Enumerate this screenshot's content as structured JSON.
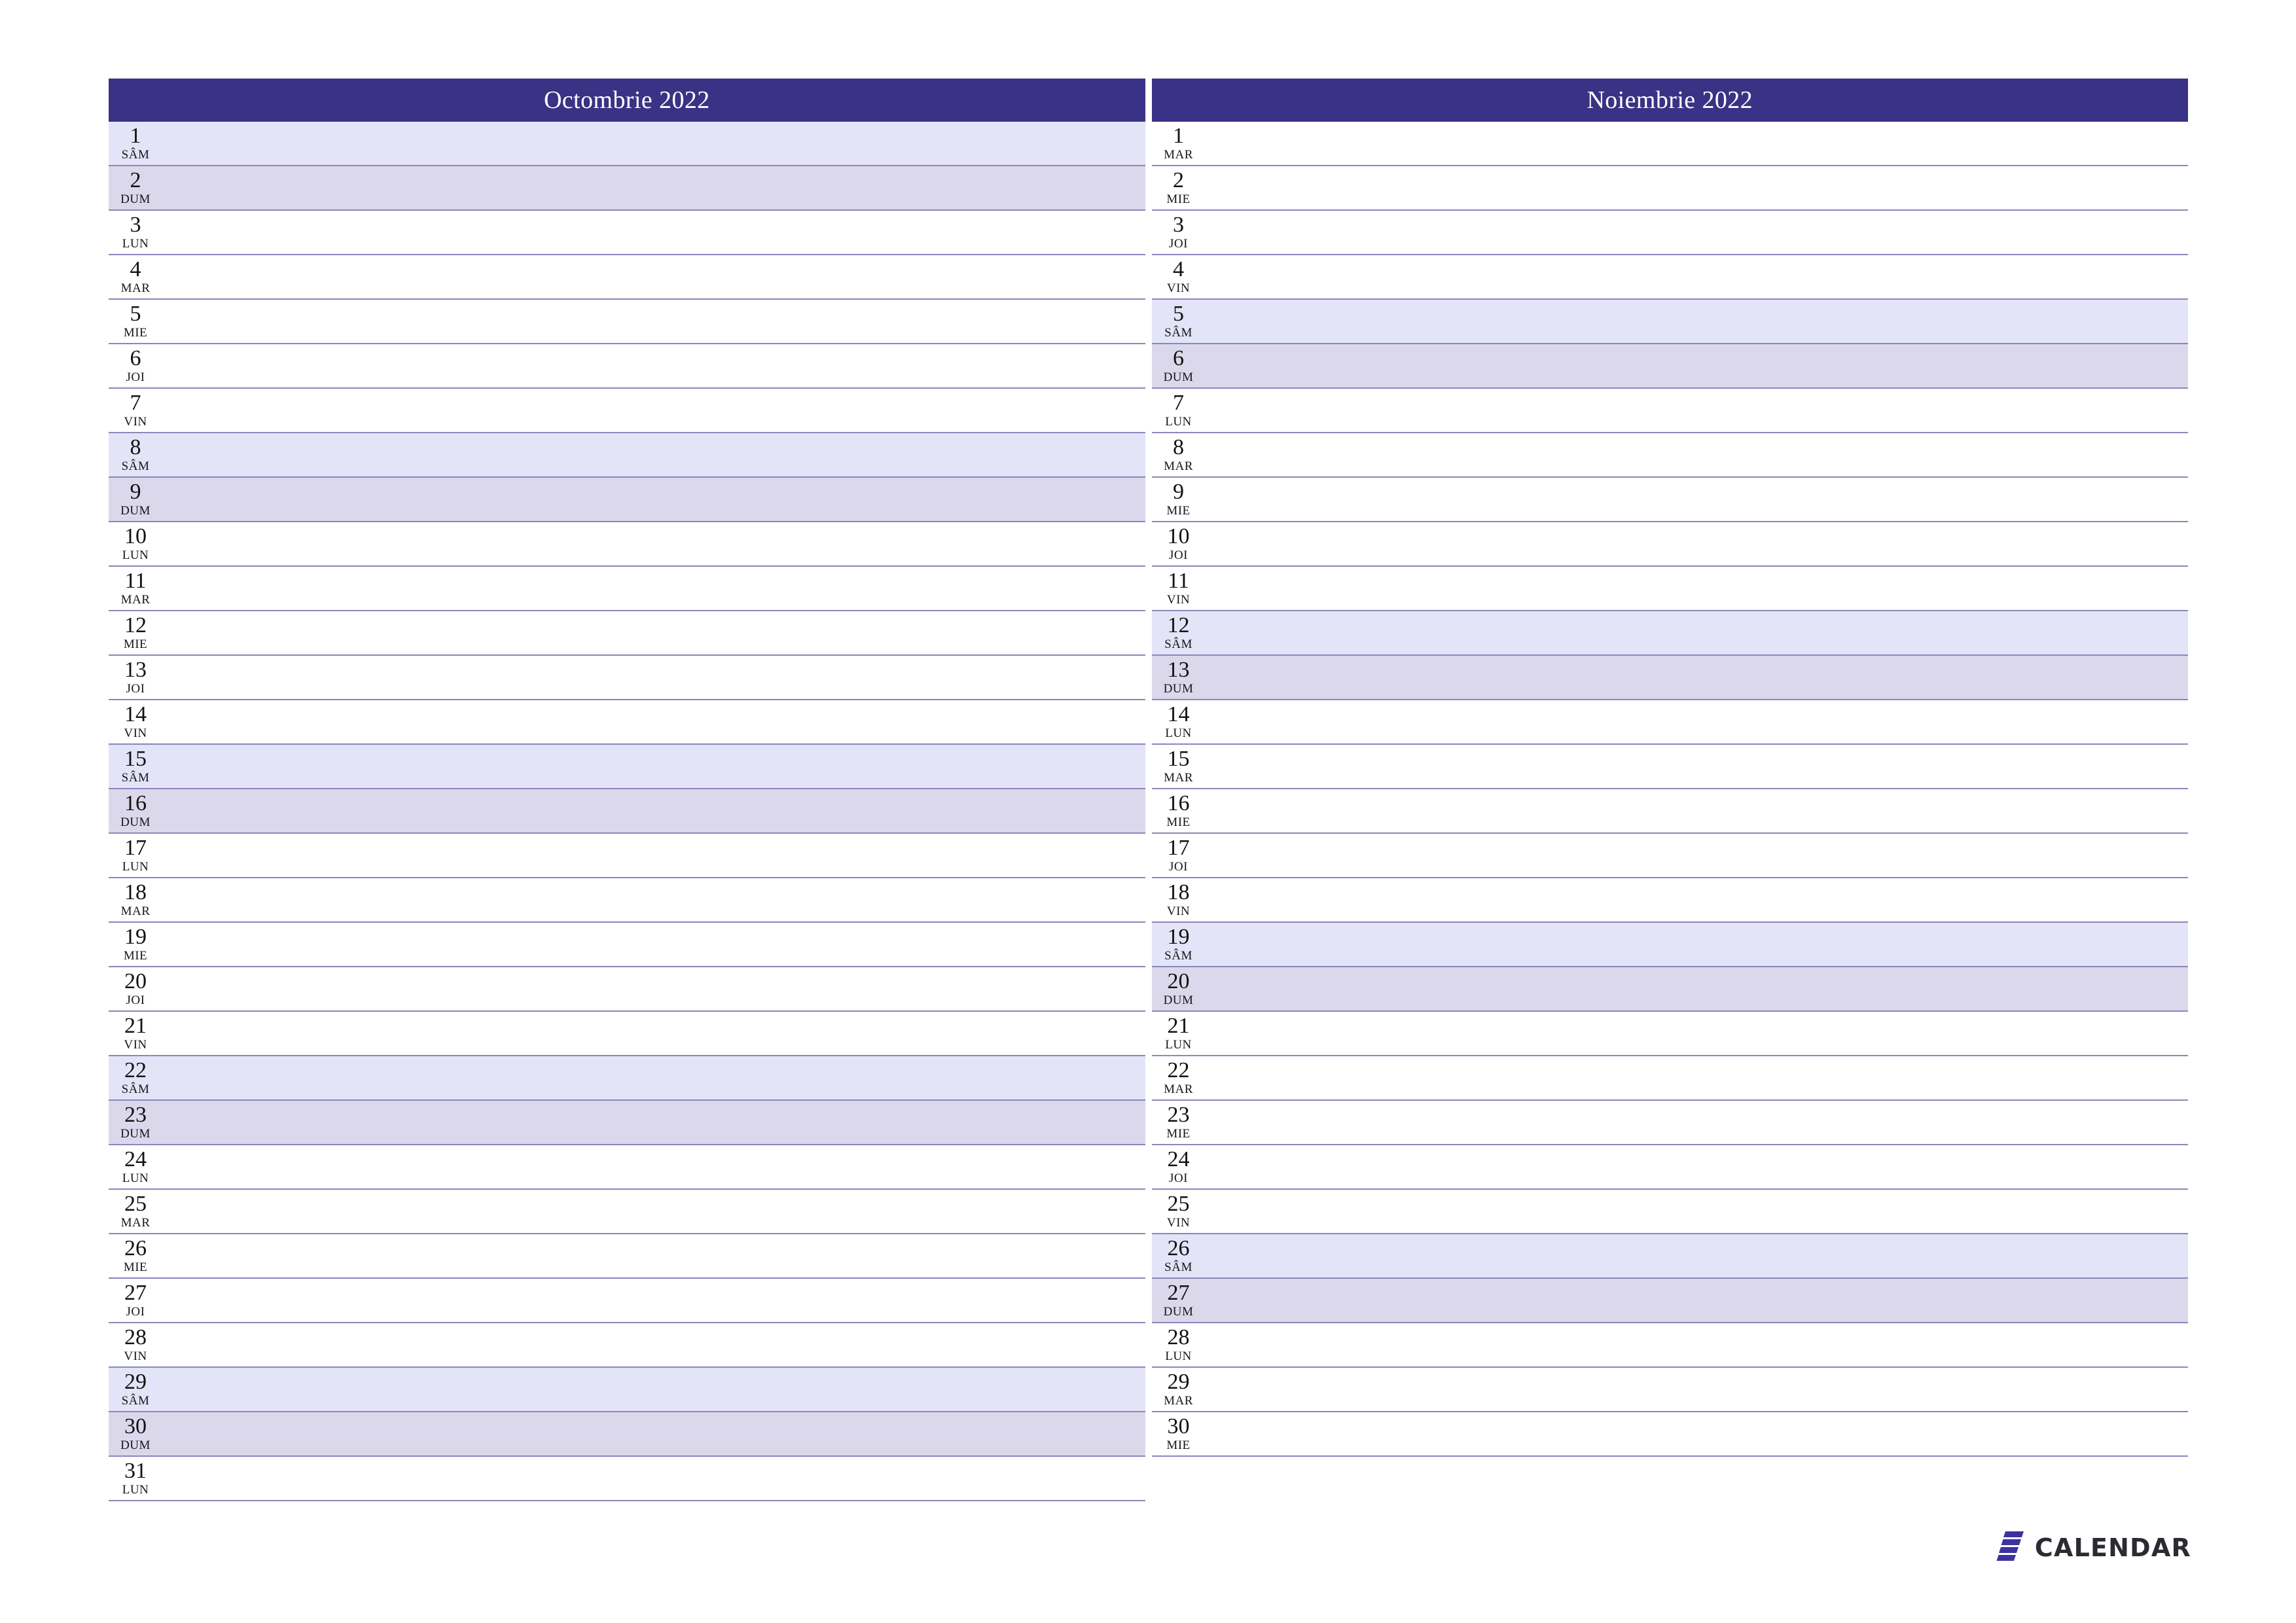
{
  "document": {
    "type": "monthly-planner",
    "language": "ro",
    "orientation": "landscape"
  },
  "months": [
    {
      "title": "Octombrie 2022",
      "days": [
        {
          "num": "1",
          "name": "SÂM",
          "kind": "sat"
        },
        {
          "num": "2",
          "name": "DUM",
          "kind": "sun"
        },
        {
          "num": "3",
          "name": "LUN",
          "kind": "weekday"
        },
        {
          "num": "4",
          "name": "MAR",
          "kind": "weekday"
        },
        {
          "num": "5",
          "name": "MIE",
          "kind": "weekday"
        },
        {
          "num": "6",
          "name": "JOI",
          "kind": "weekday"
        },
        {
          "num": "7",
          "name": "VIN",
          "kind": "weekday"
        },
        {
          "num": "8",
          "name": "SÂM",
          "kind": "sat"
        },
        {
          "num": "9",
          "name": "DUM",
          "kind": "sun"
        },
        {
          "num": "10",
          "name": "LUN",
          "kind": "weekday"
        },
        {
          "num": "11",
          "name": "MAR",
          "kind": "weekday"
        },
        {
          "num": "12",
          "name": "MIE",
          "kind": "weekday"
        },
        {
          "num": "13",
          "name": "JOI",
          "kind": "weekday"
        },
        {
          "num": "14",
          "name": "VIN",
          "kind": "weekday"
        },
        {
          "num": "15",
          "name": "SÂM",
          "kind": "sat"
        },
        {
          "num": "16",
          "name": "DUM",
          "kind": "sun"
        },
        {
          "num": "17",
          "name": "LUN",
          "kind": "weekday"
        },
        {
          "num": "18",
          "name": "MAR",
          "kind": "weekday"
        },
        {
          "num": "19",
          "name": "MIE",
          "kind": "weekday"
        },
        {
          "num": "20",
          "name": "JOI",
          "kind": "weekday"
        },
        {
          "num": "21",
          "name": "VIN",
          "kind": "weekday"
        },
        {
          "num": "22",
          "name": "SÂM",
          "kind": "sat"
        },
        {
          "num": "23",
          "name": "DUM",
          "kind": "sun"
        },
        {
          "num": "24",
          "name": "LUN",
          "kind": "weekday"
        },
        {
          "num": "25",
          "name": "MAR",
          "kind": "weekday"
        },
        {
          "num": "26",
          "name": "MIE",
          "kind": "weekday"
        },
        {
          "num": "27",
          "name": "JOI",
          "kind": "weekday"
        },
        {
          "num": "28",
          "name": "VIN",
          "kind": "weekday"
        },
        {
          "num": "29",
          "name": "SÂM",
          "kind": "sat"
        },
        {
          "num": "30",
          "name": "DUM",
          "kind": "sun"
        },
        {
          "num": "31",
          "name": "LUN",
          "kind": "weekday"
        }
      ]
    },
    {
      "title": "Noiembrie 2022",
      "days": [
        {
          "num": "1",
          "name": "MAR",
          "kind": "weekday"
        },
        {
          "num": "2",
          "name": "MIE",
          "kind": "weekday"
        },
        {
          "num": "3",
          "name": "JOI",
          "kind": "weekday"
        },
        {
          "num": "4",
          "name": "VIN",
          "kind": "weekday"
        },
        {
          "num": "5",
          "name": "SÂM",
          "kind": "sat"
        },
        {
          "num": "6",
          "name": "DUM",
          "kind": "sun"
        },
        {
          "num": "7",
          "name": "LUN",
          "kind": "weekday"
        },
        {
          "num": "8",
          "name": "MAR",
          "kind": "weekday"
        },
        {
          "num": "9",
          "name": "MIE",
          "kind": "weekday"
        },
        {
          "num": "10",
          "name": "JOI",
          "kind": "weekday"
        },
        {
          "num": "11",
          "name": "VIN",
          "kind": "weekday"
        },
        {
          "num": "12",
          "name": "SÂM",
          "kind": "sat"
        },
        {
          "num": "13",
          "name": "DUM",
          "kind": "sun"
        },
        {
          "num": "14",
          "name": "LUN",
          "kind": "weekday"
        },
        {
          "num": "15",
          "name": "MAR",
          "kind": "weekday"
        },
        {
          "num": "16",
          "name": "MIE",
          "kind": "weekday"
        },
        {
          "num": "17",
          "name": "JOI",
          "kind": "weekday"
        },
        {
          "num": "18",
          "name": "VIN",
          "kind": "weekday"
        },
        {
          "num": "19",
          "name": "SÂM",
          "kind": "sat"
        },
        {
          "num": "20",
          "name": "DUM",
          "kind": "sun"
        },
        {
          "num": "21",
          "name": "LUN",
          "kind": "weekday"
        },
        {
          "num": "22",
          "name": "MAR",
          "kind": "weekday"
        },
        {
          "num": "23",
          "name": "MIE",
          "kind": "weekday"
        },
        {
          "num": "24",
          "name": "JOI",
          "kind": "weekday"
        },
        {
          "num": "25",
          "name": "VIN",
          "kind": "weekday"
        },
        {
          "num": "26",
          "name": "SÂM",
          "kind": "sat"
        },
        {
          "num": "27",
          "name": "DUM",
          "kind": "sun"
        },
        {
          "num": "28",
          "name": "LUN",
          "kind": "weekday"
        },
        {
          "num": "29",
          "name": "MAR",
          "kind": "weekday"
        },
        {
          "num": "30",
          "name": "MIE",
          "kind": "weekday"
        }
      ]
    }
  ],
  "brand": {
    "wordmark": "CALENDAR",
    "mark_icon": "seven-bars-logo-icon"
  },
  "colors": {
    "header_bg": "#3a3285",
    "header_text": "#ffffff",
    "saturday_bg": "#e3e4f7",
    "sunday_bg": "#dcd8ec",
    "rule_line": "#8b86bb",
    "brand_mark": "#3d33a0",
    "brand_text": "#2b2b33"
  }
}
